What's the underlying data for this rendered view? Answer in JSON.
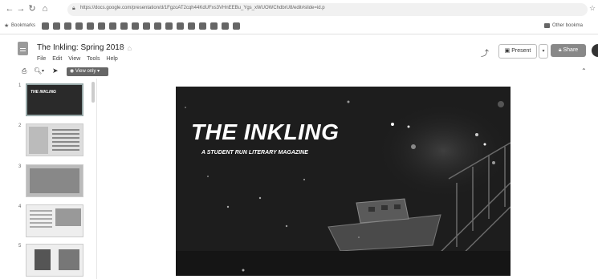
{
  "browser": {
    "url": "https://docs.google.com/presentation/d/1FgzoAT2cqh44KdUFxs3VHnEEBu_Ygs_xWUOWChdbrU8/edit#slide=id.p",
    "bookmarks_label": "Bookmarks",
    "other_bookmarks": "Other bookma"
  },
  "app": {
    "doc_title": "The Inkling: Spring 2018",
    "menus": [
      "File",
      "Edit",
      "View",
      "Tools",
      "Help"
    ],
    "present_label": "Present",
    "share_label": "Share"
  },
  "toolbar": {
    "view_only_label": "View only"
  },
  "filmstrip": {
    "slides": [
      {
        "number": "1",
        "title": "THE INKLING"
      },
      {
        "number": "2"
      },
      {
        "number": "3"
      },
      {
        "number": "4"
      },
      {
        "number": "5"
      }
    ]
  },
  "slide": {
    "title": "THE INKLING",
    "subtitle": "A STUDENT RUN LITERARY MAGAZINE"
  },
  "colors": {
    "share_button": "#888888",
    "view_only_button": "#666666",
    "slide_background": "#1e1e1e"
  }
}
